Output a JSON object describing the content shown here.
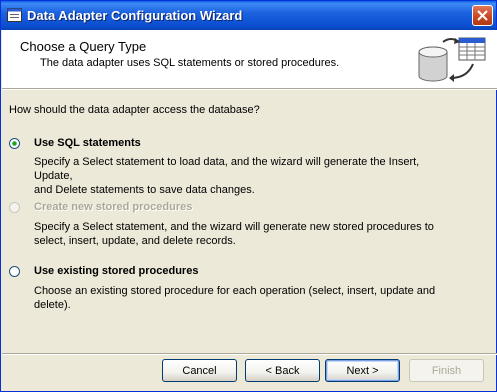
{
  "window": {
    "title": "Data Adapter Configuration Wizard"
  },
  "header": {
    "title": "Choose a Query Type",
    "subtitle": "The data adapter uses SQL statements or stored procedures."
  },
  "question": "How should the data adapter access the database?",
  "options": [
    {
      "label": "Use SQL statements",
      "selected": true,
      "enabled": true,
      "description_lines": [
        "Specify a Select statement to load data, and the wizard will generate the Insert, Update,",
        "and Delete statements to save data changes."
      ]
    },
    {
      "label": "Create new stored procedures",
      "selected": false,
      "enabled": false,
      "description_lines": [
        "Specify a Select statement, and the wizard will generate new stored procedures to",
        "select, insert, update, and delete records."
      ]
    },
    {
      "label": "Use existing stored procedures",
      "selected": false,
      "enabled": true,
      "description_lines": [
        "Choose an existing stored procedure for each operation (select, insert, update and",
        "delete)."
      ]
    }
  ],
  "buttons": {
    "cancel": "Cancel",
    "back": "< Back",
    "next": "Next >",
    "finish": "Finish",
    "finish_enabled": false
  },
  "colors": {
    "titlebar": "#0a5fe8",
    "dialog_bg": "#ece9d8",
    "close": "#c9451f"
  }
}
